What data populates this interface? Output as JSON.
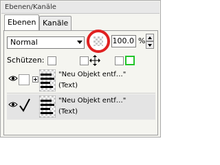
{
  "panel": {
    "title": "Ebenen/Kanäle"
  },
  "tabs": [
    {
      "label": "Ebenen",
      "active": true
    },
    {
      "label": "Kanäle",
      "active": false
    }
  ],
  "blend_mode": {
    "value": "Normal"
  },
  "opacity": {
    "value": "100.0",
    "unit": "%"
  },
  "protect": {
    "label": "Schützen:"
  },
  "layers": [
    {
      "name": "\"Neu Objekt entf…\"",
      "type": "(Text)",
      "visible": true,
      "checked": false,
      "expandable": true
    },
    {
      "name": "\"Neu Objekt entf…\"",
      "type": "(Text)",
      "visible": true,
      "checked": true,
      "expandable": false
    }
  ],
  "colors": {
    "highlight_ring": "#e02020",
    "bounds_icon": "#22c52a",
    "selected_row": "#e4e4e4"
  }
}
